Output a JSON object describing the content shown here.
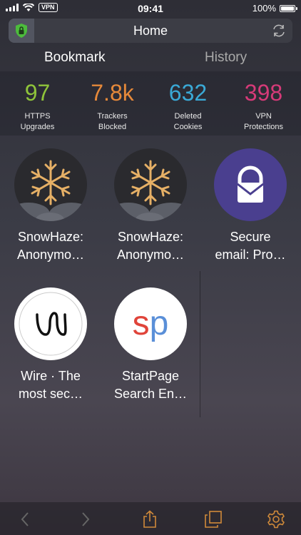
{
  "status": {
    "time": "09:41",
    "vpn": "VPN",
    "battery": "100%",
    "battery_level": 1.0
  },
  "nav": {
    "title": "Home"
  },
  "tabs": [
    {
      "label": "Bookmark",
      "active": true
    },
    {
      "label": "History",
      "active": false
    }
  ],
  "stats": [
    {
      "value": "97",
      "label": "HTTPS\nUpgrades",
      "color": "#8fc43a"
    },
    {
      "value": "7.8k",
      "label": "Trackers\nBlocked",
      "color": "#e6893a"
    },
    {
      "value": "632",
      "label": "Deleted\nCookies",
      "color": "#3aa9d6"
    },
    {
      "value": "398",
      "label": "VPN\nProtections",
      "color": "#d63a78"
    }
  ],
  "bookmarks": [
    {
      "label": "SnowHaze:\nAnonymo…",
      "icon": "snowflake-icon"
    },
    {
      "label": "SnowHaze:\nAnonymo…",
      "icon": "snowflake-icon"
    },
    {
      "label": "Secure\nemail: Pro…",
      "icon": "protonmail-icon"
    },
    {
      "label": "Wire · The\nmost sec…",
      "icon": "wire-icon"
    },
    {
      "label": "StartPage\nSearch En…",
      "icon": "startpage-icon",
      "icon_text": "sp"
    }
  ],
  "colors": {
    "accent_green": "#4cbc3c",
    "snowflake_gold": "#e6b066",
    "proton_purple": "#4a3f8f",
    "startpage_red": "#e0443a",
    "startpage_blue": "#5a8fd8"
  }
}
